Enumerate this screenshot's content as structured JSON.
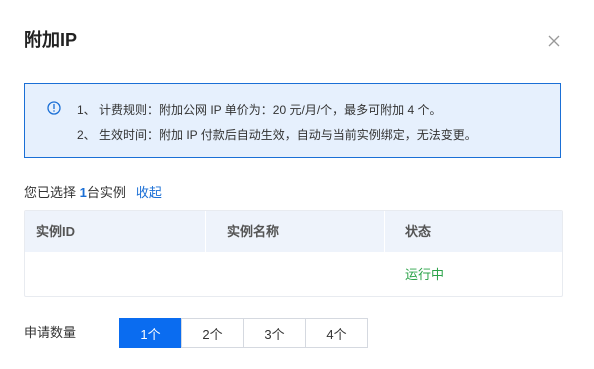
{
  "dialog": {
    "title": "附加IP",
    "close_icon": "close-icon"
  },
  "notice": {
    "icon": "info-circle-icon",
    "accent_color": "#1a6fd6",
    "line1": "1、 计费规则：附加公网 IP 单价为：20 元/月/个，最多可附加 4 个。",
    "line2": "2、 生效时间：附加 IP 付款后自动生效，自动与当前实例绑定，无法变更。"
  },
  "selection": {
    "prefix": "您已选择 ",
    "count": "1",
    "suffix": "台实例",
    "collapse_label": "收起"
  },
  "table": {
    "columns": [
      "实例ID",
      "实例名称",
      "状态"
    ],
    "rows": [
      {
        "instance_id": "",
        "instance_name": "",
        "status": "运行中"
      }
    ],
    "status_color": "#2ba349"
  },
  "quantity": {
    "label": "申请数量",
    "options": [
      "1个",
      "2个",
      "3个",
      "4个"
    ],
    "selected": "1个",
    "active_color": "#0a6cf0"
  }
}
